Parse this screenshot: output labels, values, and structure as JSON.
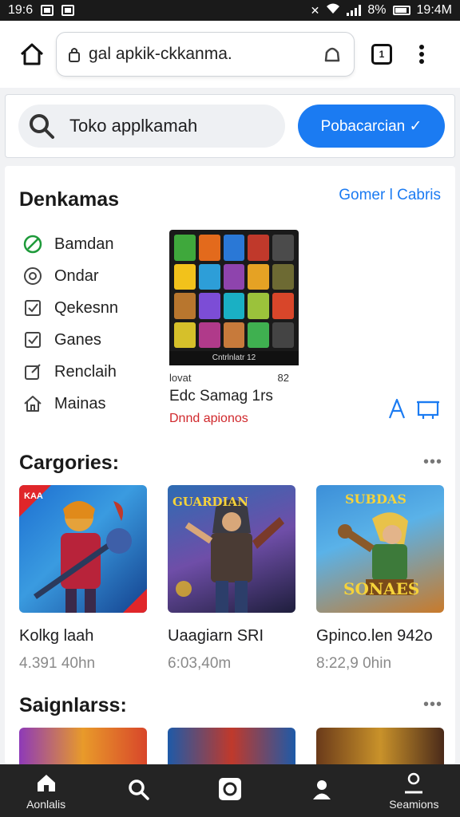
{
  "status_bar": {
    "time_left": "19:6",
    "battery_text": "8%",
    "time_right": "19:4M"
  },
  "browser": {
    "url": "gal apkik-ckkanma.",
    "tabs_count": "1"
  },
  "search": {
    "placeholder": "Toko applkamah",
    "button_label": "Pobacarcian ✓"
  },
  "featured_section": {
    "title": "Denkamas",
    "link": "Gomer l Cabris",
    "menu": [
      {
        "label": "Bamdan",
        "icon": "leaf-icon"
      },
      {
        "label": "Ondar",
        "icon": "disc-icon"
      },
      {
        "label": "Qekesnn",
        "icon": "checkbox-icon"
      },
      {
        "label": "Ganes",
        "icon": "checkbox-icon"
      },
      {
        "label": "Renclaih",
        "icon": "edit-icon"
      },
      {
        "label": "Mainas",
        "icon": "home-icon"
      }
    ],
    "featured_app": {
      "image_caption": "Cntrlnlatr 12",
      "meta_left": "lovat",
      "meta_right": "82",
      "title": "Edc Samag 1rs",
      "subtitle": "Dnnd apionos"
    }
  },
  "categories_section": {
    "title": "Cargories:",
    "cards": [
      {
        "title": "Kolkg laah",
        "subtitle": "4.391 40hn",
        "badge": "KAA"
      },
      {
        "title": "Uaagiarn SRI",
        "subtitle": "6:03,40m",
        "banner": "GUARDIAN"
      },
      {
        "title": "Gpinco.len 942o",
        "subtitle": "8:22,9 0hin",
        "banner": "SUBDAS",
        "banner2": "SONAES"
      }
    ]
  },
  "second_section": {
    "title": "Saignlarss:"
  },
  "bottom_nav": [
    {
      "label": "Aonlalis",
      "icon": "home-icon"
    },
    {
      "label": "",
      "icon": "search-icon"
    },
    {
      "label": "",
      "icon": "camera-icon"
    },
    {
      "label": "",
      "icon": "user-icon"
    },
    {
      "label": "Seamions",
      "icon": "profile-icon"
    }
  ],
  "colors": {
    "accent": "#1b7bf2",
    "red_text": "#d0282c",
    "nav_bg": "#242424"
  }
}
